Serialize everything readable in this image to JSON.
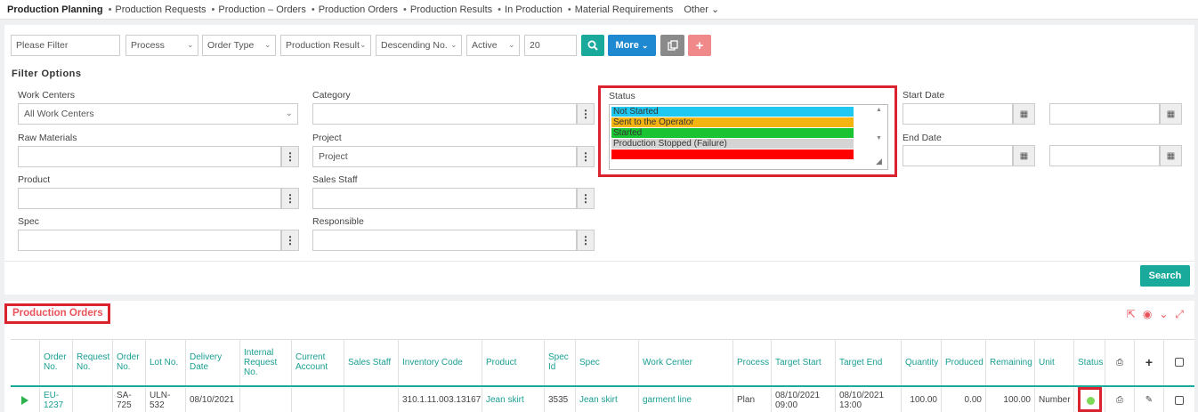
{
  "nav": {
    "brand": "Production Planning",
    "items": [
      "Production Requests",
      "Production – Orders",
      "Production Orders",
      "Production Results",
      "In Production",
      "Material Requirements"
    ],
    "other": "Other"
  },
  "toolbar": {
    "filter_placeholder": "Please Filter",
    "process": "Process",
    "order_type": "Order Type",
    "production_result": "Production Result",
    "sort": "Descending No.",
    "active": "Active",
    "page_size": "20",
    "more_label": "More",
    "colors": {
      "search": "#1aaa9c",
      "more": "#1e88d0",
      "copy": "#8a8a8a",
      "add": "#f08a8a"
    }
  },
  "filter": {
    "title": "Filter Options",
    "work_centers_label": "Work Centers",
    "work_centers_value": "All Work Centers",
    "category_label": "Category",
    "status_label": "Status",
    "start_date_label": "Start Date",
    "raw_materials_label": "Raw Materials",
    "project_label": "Project",
    "project_value": "Project",
    "end_date_label": "End Date",
    "product_label": "Product",
    "sales_staff_label": "Sales Staff",
    "spec_label": "Spec",
    "responsible_label": "Responsible",
    "search_label": "Search",
    "status_options": [
      {
        "label": "Not Started",
        "color": "#1ec8f0"
      },
      {
        "label": "Sent to the Operator",
        "color": "#f5b40f"
      },
      {
        "label": "Started",
        "color": "#19c332"
      },
      {
        "label": "Production Stopped (Failure)",
        "color": "#d4d4d4"
      },
      {
        "label": "",
        "color": "#ff0000"
      }
    ]
  },
  "orders": {
    "title": "Production Orders",
    "columns": [
      "Order No.",
      "Request No.",
      "Order No.",
      "Lot No.",
      "Delivery Date",
      "Internal Request No.",
      "Current Account",
      "Sales Staff",
      "Inventory Code",
      "Product",
      "Spec Id",
      "Spec",
      "Work Center",
      "Process",
      "Target Start",
      "Target End",
      "Quantity",
      "Produced",
      "Remaining",
      "Unit",
      "Status"
    ],
    "row": {
      "order_no": "EU-1237",
      "request_no": "",
      "order_no2": "SA-725",
      "lot_no": "ULN-532",
      "delivery_date": "08/10/2021",
      "internal_request_no": "",
      "current_account": "",
      "sales_staff": "",
      "inventory_code": "310.1.11.003.13167",
      "product": "Jean skirt",
      "spec_id": "3535",
      "spec": "Jean skirt",
      "work_center": "garment line",
      "process": "Plan",
      "target_start": "08/10/2021 09:00",
      "target_end": "08/10/2021 13:00",
      "quantity": "100.00",
      "produced": "0.00",
      "remaining": "100.00",
      "unit": "Number",
      "status_color": "#7ed957"
    }
  }
}
